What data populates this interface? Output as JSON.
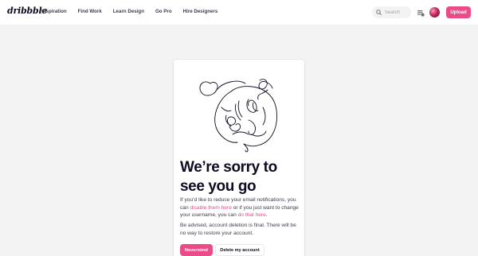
{
  "header": {
    "logo": "dribbble",
    "nav": [
      "Inspiration",
      "Find Work",
      "Learn Design",
      "Go Pro",
      "Hire Designers"
    ],
    "search_placeholder": "Search",
    "upload_label": "Upload"
  },
  "card": {
    "title": "We’re sorry to see you go",
    "p1_start": "If you’d like to reduce your email notifications, you can ",
    "p1_link1": "disable them here",
    "p1_mid": " or if you just want to change your username, you can ",
    "p1_link2": "do that here",
    "p1_end": ".",
    "p2": "Be advised, account deletion is final. There will be no way to restore your account.",
    "nevermind_label": "Nevermind",
    "delete_label": "Delete my account"
  },
  "colors": {
    "accent": "#ea4c89",
    "text": "#0d0c22",
    "background": "#f4f3f4"
  },
  "icons": [
    "search-icon",
    "notifications-icon"
  ]
}
